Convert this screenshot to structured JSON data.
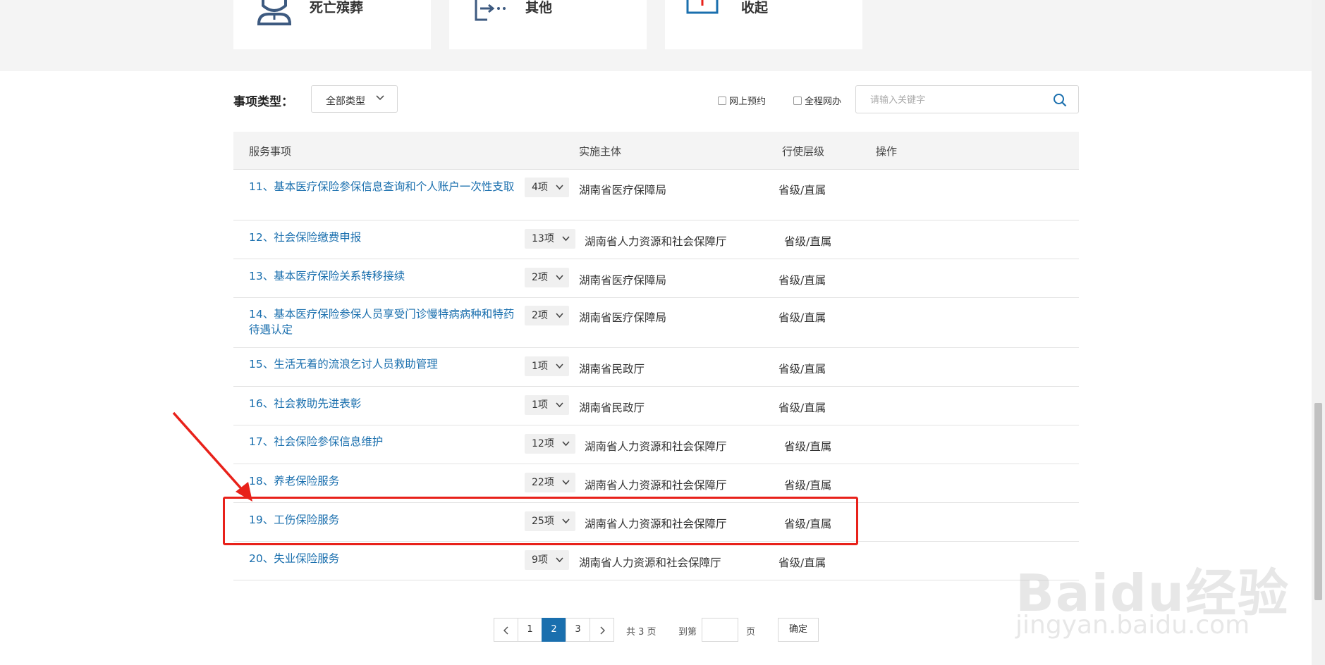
{
  "categories": [
    {
      "label": "死亡殡葬",
      "icon": "person-icon"
    },
    {
      "label": "其他",
      "icon": "list-arrow-icon"
    },
    {
      "label": "收起",
      "icon": "collapse-icon"
    }
  ],
  "filter": {
    "label": "事项类型：",
    "type_select": "全部类型",
    "online_booking": "网上预约",
    "full_online": "全程网办",
    "search_placeholder": "请输入关键字"
  },
  "table": {
    "headers": {
      "item": "服务事项",
      "agency": "实施主体",
      "level": "行使层级",
      "action": "操作"
    },
    "rows": [
      {
        "name": "11、基本医疗保险参保信息查询和个人账户一次性支取",
        "count": "4项",
        "agency": "湖南省医疗保障局",
        "level": "省级/直属"
      },
      {
        "name": "12、社会保险缴费申报",
        "count": "13项",
        "agency": "湖南省人力资源和社会保障厅",
        "level": "省级/直属"
      },
      {
        "name": "13、基本医疗保险关系转移接续",
        "count": "2项",
        "agency": "湖南省医疗保障局",
        "level": "省级/直属"
      },
      {
        "name": "14、基本医疗保险参保人员享受门诊慢特病病种和特药待遇认定",
        "count": "2项",
        "agency": "湖南省医疗保障局",
        "level": "省级/直属"
      },
      {
        "name": "15、生活无着的流浪乞讨人员救助管理",
        "count": "1项",
        "agency": "湖南省民政厅",
        "level": "省级/直属"
      },
      {
        "name": "16、社会救助先进表彰",
        "count": "1项",
        "agency": "湖南省民政厅",
        "level": "省级/直属"
      },
      {
        "name": "17、社会保险参保信息维护",
        "count": "12项",
        "agency": "湖南省人力资源和社会保障厅",
        "level": "省级/直属"
      },
      {
        "name": "18、养老保险服务",
        "count": "22项",
        "agency": "湖南省人力资源和社会保障厅",
        "level": "省级/直属"
      },
      {
        "name": "19、工伤保险服务",
        "count": "25项",
        "agency": "湖南省人力资源和社会保障厅",
        "level": "省级/直属"
      },
      {
        "name": "20、失业保险服务",
        "count": "9项",
        "agency": "湖南省人力资源和社会保障厅",
        "level": "省级/直属"
      }
    ]
  },
  "pagination": {
    "pages": [
      "1",
      "2",
      "3"
    ],
    "current": "2",
    "total": "共 3 页",
    "goto_label": "到第",
    "page_unit": "页",
    "confirm": "确定"
  },
  "watermark": {
    "text": "Baidu经验",
    "sub": "jingyan.baidu.com"
  },
  "colors": {
    "link": "#1a6fae",
    "highlight": "#e8211a",
    "active_page": "#1a6fae"
  }
}
